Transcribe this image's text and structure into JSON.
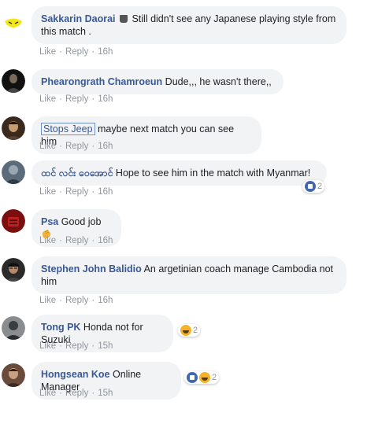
{
  "actions": {
    "like": "Like",
    "reply": "Reply",
    "sep": "·"
  },
  "comments": [
    {
      "author": "Sakkarin Daorai",
      "text": " Still didn't see any Japanese playing style from this match .",
      "time": "16h"
    },
    {
      "author": "Phearongrath Chamroeun",
      "text": " Dude,,, he wasn't there,,",
      "time": "16h"
    },
    {
      "author": "Stops Jeep",
      "text": " maybe next match you can see him",
      "time": "16h"
    },
    {
      "author": "ထင် လင်း ဝေအောင်",
      "text": " Hope to see him in the match with Myanmar!",
      "time": "16h",
      "reactions": "2"
    },
    {
      "author": "Psa",
      "text": " Good job",
      "time": "16h"
    },
    {
      "author": "Stephen John Balidio",
      "text": " An argetinian coach manage Cambodia not him",
      "time": "16h"
    },
    {
      "author": "Tong PK",
      "text": " Honda not for Suzuki",
      "time": "15h",
      "reactions": "2"
    },
    {
      "author": "Hongsean Koe",
      "text": " Online Manager",
      "time": "15h",
      "reactions": "2"
    }
  ],
  "colors": {
    "link": "#385898",
    "bubble": "#f2f3f5",
    "meta": "#90949c",
    "like": "#4267b2",
    "haha": "#f7b125"
  }
}
